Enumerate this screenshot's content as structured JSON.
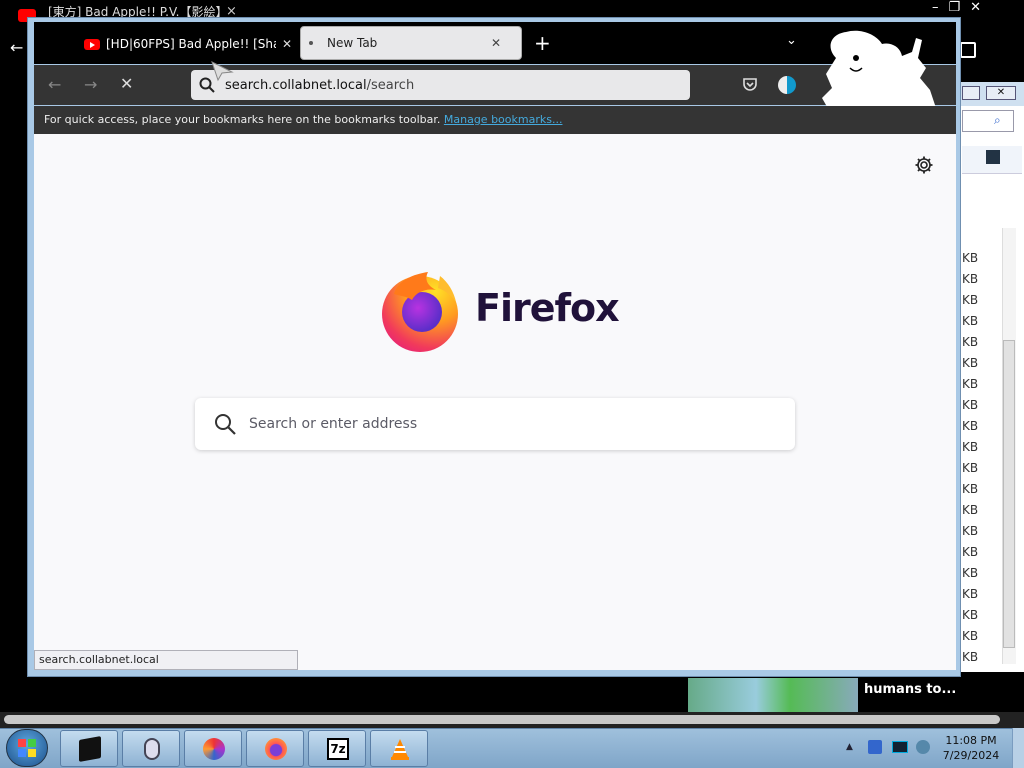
{
  "background_window": {
    "tab_title": "[東方] Bad Apple!! P.V.【影絵】",
    "close_glyph": "×",
    "window_controls": [
      "–",
      "❐",
      "✕"
    ],
    "back_glyph": "←",
    "video_title": "humans to..."
  },
  "explorer_window": {
    "close_glyph": "✕",
    "search_glyph": "⌕",
    "size_unit_cells": [
      "KB",
      "KB",
      "KB",
      "KB",
      "KB",
      "KB",
      "KB",
      "KB",
      "KB",
      "KB",
      "KB",
      "KB",
      "KB",
      "KB",
      "KB",
      "KB",
      "KB",
      "KB",
      "KB",
      "KB"
    ]
  },
  "browser": {
    "tabs": [
      {
        "label": "[HD|60FPS] Bad Apple!! [Shadow",
        "close": "✕",
        "active": false
      },
      {
        "label": "New Tab",
        "close": "✕",
        "active": true
      }
    ],
    "new_tab_glyph": "+",
    "tab_list_glyph": "⌄",
    "window_controls": {
      "minimize": "▁",
      "maximize": "▢",
      "close": "✕"
    },
    "nav": {
      "back": "←",
      "forward": "→",
      "stop": "✕"
    },
    "url": {
      "host": "search.collabnet.local",
      "path": "/search"
    },
    "ublock_label": "uO",
    "bookmarks_bar": {
      "message": "For quick access, place your bookmarks here on the bookmarks toolbar.",
      "link": "Manage bookmarks..."
    },
    "content": {
      "wordmark": "Firefox",
      "search_placeholder": "Search or enter address"
    },
    "status_text": "search.collabnet.local"
  },
  "taskbar": {
    "time": "11:08 PM",
    "date": "7/29/2024",
    "tray_up": "▲",
    "apps": [
      "terminal-icon",
      "mouse-icon",
      "thunderbird-icon",
      "firefox-icon",
      "7zip-icon",
      "vlc-icon"
    ],
    "sevenzip_label": "7z"
  },
  "colors": {
    "tabbar_bg": "#000000",
    "toolbar_bg": "#343434",
    "content_bg": "#f9f9fb",
    "link": "#44aadd",
    "taskbar": "#8eb2d3"
  }
}
